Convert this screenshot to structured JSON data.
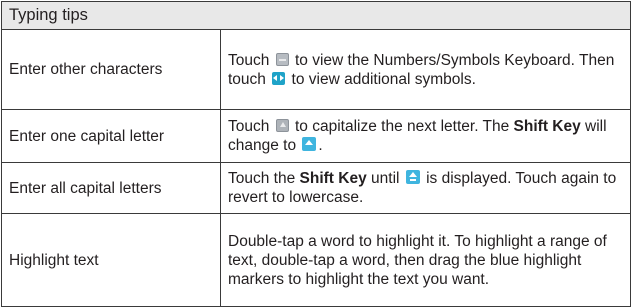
{
  "table": {
    "title": "Typing tips",
    "rows": [
      {
        "label": "Enter other characters",
        "t1": "Touch ",
        "icon1": "symbols-key-icon",
        "t2": " to view the Numbers/Symbols Keyboard. Then touch ",
        "icon2": "page-arrows-icon",
        "t3": " to view additional symbols."
      },
      {
        "label": "Enter one capital letter",
        "t1": "Touch ",
        "icon1": "shift-key-icon",
        "t2": " to capitalize the next letter. The ",
        "bold": "Shift Key",
        "t3": " will change to ",
        "icon2": "shift-active-icon",
        "t4": "."
      },
      {
        "label": "Enter all capital letters",
        "t1": "Touch the ",
        "bold": "Shift Key",
        "t2": " until ",
        "icon1": "shift-lock-icon",
        "t3": " is displayed. Touch again to revert to lowercase."
      },
      {
        "label": "Highlight text",
        "text": "Double-tap a word to highlight it. To highlight a range of text, double-tap a word, then drag the blue highlight markers to highlight the text you want."
      }
    ]
  }
}
